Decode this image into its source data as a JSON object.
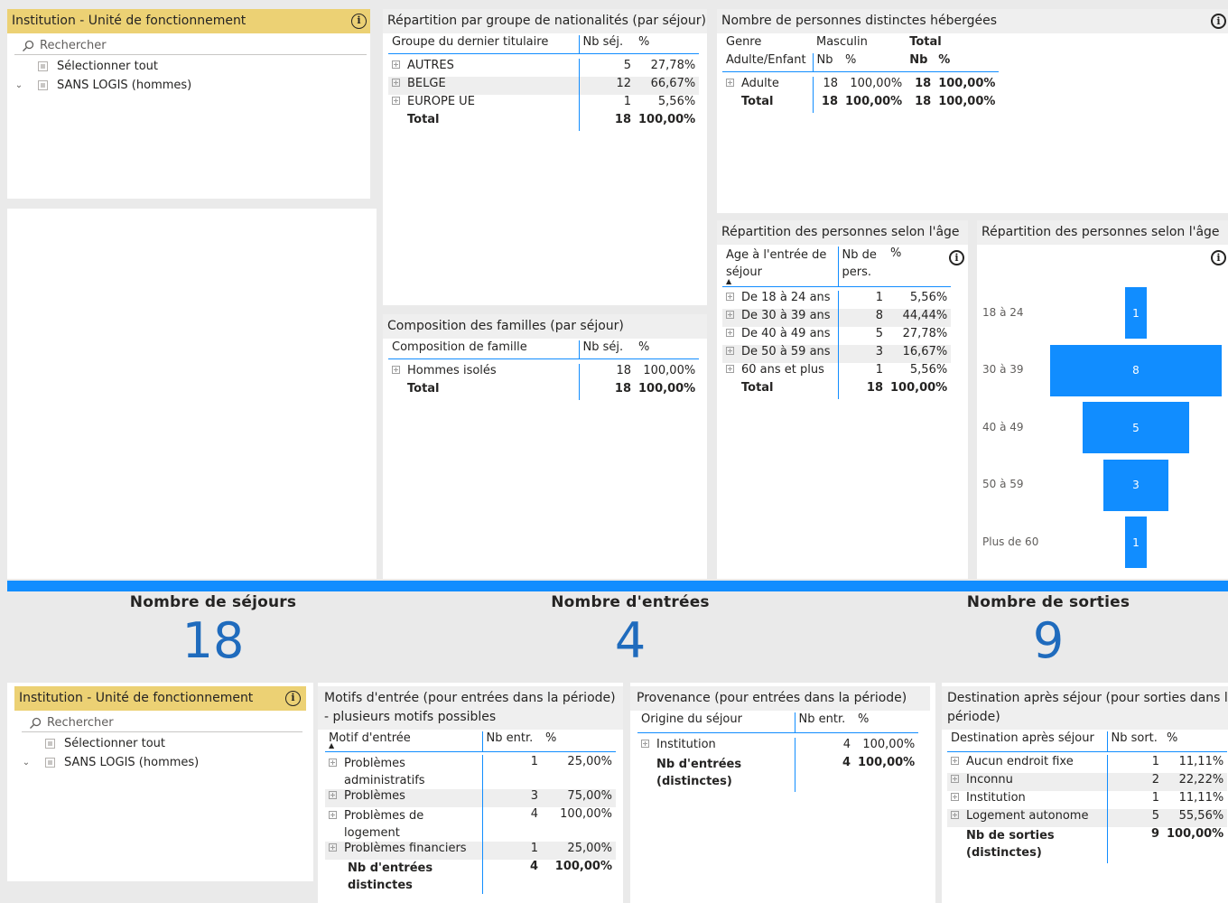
{
  "colors": {
    "accent": "#118dff",
    "slicer_header": "#ecd174",
    "kpi": "#1f6bbd"
  },
  "slicer": {
    "title": "Institution - Unité de fonctionnement",
    "search_placeholder": "Rechercher",
    "select_all": "Sélectionner tout",
    "items": [
      "SANS LOGIS (hommes)"
    ]
  },
  "nationalites": {
    "title": "Répartition par groupe de nationalités (par séjour)",
    "headers": [
      "Groupe du dernier titulaire",
      "Nb séj.",
      "%"
    ],
    "rows": [
      {
        "label": "AUTRES",
        "nb": "5",
        "pct": "27,78%"
      },
      {
        "label": "BELGE",
        "nb": "12",
        "pct": "66,67%"
      },
      {
        "label": "EUROPE UE",
        "nb": "1",
        "pct": "5,56%"
      }
    ],
    "total": {
      "label": "Total",
      "nb": "18",
      "pct": "100,00%"
    }
  },
  "personnes": {
    "title": "Nombre de personnes distinctes hébergées",
    "h_genre": "Genre",
    "h_masculin": "Masculin",
    "h_total": "Total",
    "h_adulte_enfant": "Adulte/Enfant",
    "h_nb": "Nb",
    "h_pct": "%",
    "rows": [
      {
        "label": "Adulte",
        "nb": "18",
        "pct": "100,00%",
        "tnb": "18",
        "tpct": "100,00%"
      }
    ],
    "total": {
      "label": "Total",
      "nb": "18",
      "pct": "100,00%",
      "tnb": "18",
      "tpct": "100,00%"
    }
  },
  "familles": {
    "title": "Composition des familles (par séjour)",
    "headers": [
      "Composition de famille",
      "Nb séj.",
      "%"
    ],
    "rows": [
      {
        "label": "Hommes isolés",
        "nb": "18",
        "pct": "100,00%"
      }
    ],
    "total": {
      "label": "Total",
      "nb": "18",
      "pct": "100,00%"
    }
  },
  "age_table": {
    "title": "Répartition des personnes selon l'âge",
    "headers": [
      "Age à l'entrée de séjour",
      "Nb de pers.",
      "%"
    ],
    "rows": [
      {
        "label": "De 18 à 24 ans",
        "nb": "1",
        "pct": "5,56%"
      },
      {
        "label": "De 30 à 39 ans",
        "nb": "8",
        "pct": "44,44%"
      },
      {
        "label": "De 40 à 49 ans",
        "nb": "5",
        "pct": "27,78%"
      },
      {
        "label": "De 50 à 59 ans",
        "nb": "3",
        "pct": "16,67%"
      },
      {
        "label": "60 ans et plus",
        "nb": "1",
        "pct": "5,56%"
      }
    ],
    "total": {
      "label": "Total",
      "nb": "18",
      "pct": "100,00%"
    }
  },
  "age_funnel": {
    "title": "Répartition des personnes selon l'âge",
    "categories": [
      "18 à 24",
      "30 à 39",
      "40 à 49",
      "50 à 59",
      "Plus de 60"
    ],
    "values": [
      1,
      8,
      5,
      3,
      1
    ]
  },
  "kpis": {
    "sejours": {
      "label": "Nombre de séjours",
      "value": "18"
    },
    "entrees": {
      "label": "Nombre d'entrées",
      "value": "4"
    },
    "sorties": {
      "label": "Nombre de sorties",
      "value": "9"
    }
  },
  "motifs": {
    "title": "Motifs d'entrée (pour entrées dans la période) - plusieurs motifs possibles",
    "headers": [
      "Motif d'entrée",
      "Nb entr.",
      "%"
    ],
    "rows": [
      {
        "label": "Problèmes administratifs",
        "nb": "1",
        "pct": "25,00%"
      },
      {
        "label": "Problèmes",
        "nb": "3",
        "pct": "75,00%"
      },
      {
        "label": "Problèmes de logement",
        "nb": "4",
        "pct": "100,00%"
      },
      {
        "label": "Problèmes financiers",
        "nb": "1",
        "pct": "25,00%"
      }
    ],
    "total": {
      "label": "Nb d'entrées distinctes",
      "nb": "4",
      "pct": "100,00%"
    }
  },
  "provenance": {
    "title": "Provenance (pour entrées dans la période)",
    "headers": [
      "Origine du séjour",
      "Nb entr.",
      "%"
    ],
    "rows": [
      {
        "label": "Institution",
        "nb": "4",
        "pct": "100,00%"
      }
    ],
    "total": {
      "label": "Nb d'entrées (distinctes)",
      "nb": "4",
      "pct": "100,00%"
    }
  },
  "destination": {
    "title": "Destination après séjour (pour sorties dans la période)",
    "headers": [
      "Destination après séjour",
      "Nb sort.",
      "%"
    ],
    "rows": [
      {
        "label": "Aucun endroit fixe",
        "nb": "1",
        "pct": "11,11%"
      },
      {
        "label": "Inconnu",
        "nb": "2",
        "pct": "22,22%"
      },
      {
        "label": "Institution",
        "nb": "1",
        "pct": "11,11%"
      },
      {
        "label": "Logement autonome",
        "nb": "5",
        "pct": "55,56%"
      }
    ],
    "total": {
      "label": "Nb de sorties (distinctes)",
      "nb": "9",
      "pct": "100,00%"
    }
  }
}
